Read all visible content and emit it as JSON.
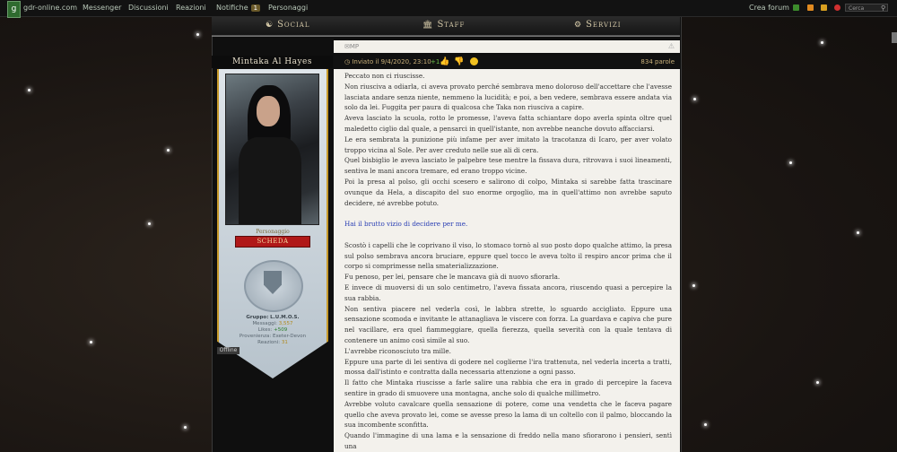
{
  "topnav": {
    "site": "gdr-online.com",
    "items": [
      "Messenger",
      "Discussioni",
      "Reazioni",
      "Notifiche",
      "Personaggi"
    ],
    "notifiche_badge": "1",
    "crea_forum": "Crea forum",
    "search_placeholder": "Cerca"
  },
  "tabs": [
    "Social",
    "Staff",
    "Servizi"
  ],
  "post": {
    "mp": "MP",
    "author": "Mintaka Al Hayes",
    "sent": "Inviato il 9/4/2020, 23:10",
    "plus": "+1",
    "words": "834 parole"
  },
  "profile": {
    "role": "Personaggio",
    "scheda": "SCHEDA",
    "group_label": "Gruppo:",
    "group_value": "L.U.M.O.S.",
    "messaggi_label": "Messaggi:",
    "messaggi_value": "3,557",
    "likes_label": "Likes:",
    "likes_value": "+509",
    "provenienza_label": "Provenienza:",
    "provenienza_value": "Exeter-Devon",
    "reazioni_label": "Reazioni:",
    "reazioni_value": "31",
    "status": "Offline"
  },
  "paragraphs": [
    "Peccato non ci riuscisse.",
    "Non riusciva a odiarla, ci aveva provato perché sembrava meno doloroso dell'accettare che l'avesse lasciata andare senza niente, nemmeno la lucidità; e poi, a ben vedere, sembrava essere andata via solo da lei. Fuggita per paura di qualcosa che Taka non riusciva a capire.",
    "Aveva lasciato la scuola, rotto le promesse, l'aveva fatta schiantare dopo averla spinta oltre quel maledetto ciglio dal quale, a pensarci in quell'istante, non avrebbe neanche dovuto affacciarsi.",
    "Le era sembrata la punizione più infame per aver imitato la tracotanza di Icaro, per aver volato troppo vicina al Sole. Per aver creduto nelle sue ali di cera.",
    "Quel bisbiglio le aveva lasciato le palpebre tese mentre la fissava dura, ritrovava i suoi lineamenti, sentiva le mani ancora tremare, ed erano troppo vicine.",
    "Poi la presa al polso, gli occhi scesero e salirono di colpo, Mintaka si sarebbe fatta trascinare ovunque da Hela, a discapito del suo enorme orgoglio, ma in quell'attimo non avrebbe saputo decidere, né avrebbe potuto.",
    "",
    "Hai il brutto vizio di decidere per me.",
    "",
    "Scostò i capelli che le coprivano il viso, lo stomaco tornò al suo posto dopo qualche attimo, la presa sul polso sembrava ancora bruciare, eppure quel tocco le aveva tolto il respiro ancor prima che il corpo si comprimesse nella smaterializzazione.",
    "Fu penoso, per lei, pensare che le mancava già di nuovo sfiorarla.",
    "E invece di muoversi di un solo centimetro, l'aveva fissata ancora, riuscendo quasi a percepire la sua rabbia.",
    "Non sentiva piacere nel vederla così, le labbra strette, lo sguardo accigliato. Eppure una sensazione scomoda e invitante le attanagliava le viscere con forza. La guardava e capiva che pure nel vacillare, era quel fiammeggiare, quella fierezza, quella severità con la quale tentava di contenere un animo così simile al suo.",
    "L'avrebbe riconosciuto tra mille.",
    "Eppure una parte di lei sentiva di godere nel coglierne l'ira trattenuta, nel vederla incerta a tratti, mossa dall'istinto e contratta dalla necessaria attenzione a ogni passo.",
    "Il fatto che Mintaka riuscisse a farle salire una rabbia che era in grado di percepire la faceva sentire in grado di smuovere una montagna, anche solo di qualche millimetro.",
    "Avrebbe voluto cavalcare quella sensazione di potere, come una vendetta che le faceva pagare quello che aveva provato lei, come se avesse preso la lama di un coltello con il palmo, bloccando la sua incombente sconfitta.",
    "Quando l'immagine di una lama e la sensazione di freddo nella mano sfiorarono i pensieri, sentì una"
  ]
}
